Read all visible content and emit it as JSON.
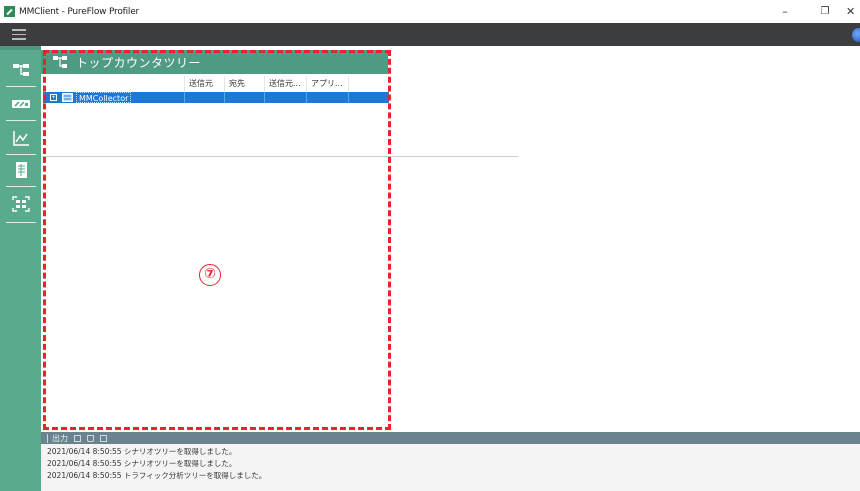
{
  "window": {
    "title": "MMClient - PureFlow Profiler",
    "minimize_glyph": "–",
    "maximize_glyph": "❐",
    "close_glyph": "✕"
  },
  "nav": {
    "items": [
      {
        "name": "topology",
        "icon": "tree-network-icon"
      },
      {
        "name": "traffic",
        "icon": "speedometer-icon"
      },
      {
        "name": "graph",
        "icon": "line-chart-icon"
      },
      {
        "name": "report",
        "icon": "document-grid-icon"
      },
      {
        "name": "capture",
        "icon": "capture-frame-icon"
      }
    ]
  },
  "panel": {
    "title": "トップカウンタツリー",
    "icon": "tree-network-icon"
  },
  "grid": {
    "columns": [
      "",
      "送信元",
      "宛先",
      "送信元...",
      "アプリ...",
      ""
    ],
    "rows": [
      {
        "expander": "+",
        "icon": "server-icon",
        "label": "MMCollector",
        "selected": true
      }
    ]
  },
  "annotation": {
    "marker": "⑦",
    "color": "#e8242a"
  },
  "output": {
    "title": "出力",
    "log": [
      "2021/06/14 8:50:55 シナリオツリーを取得しました。",
      "2021/06/14 8:50:55 シナリオツリーを取得しました。",
      "2021/06/14 8:50:55 トラフィック分析ツリーを取得しました。"
    ]
  },
  "colors": {
    "nav_rail": "#5aaa8e",
    "panel_header": "#4f9b85",
    "selection": "#1e78d7",
    "menubar": "#3b3d3e",
    "output_toolbar": "#69848f"
  }
}
